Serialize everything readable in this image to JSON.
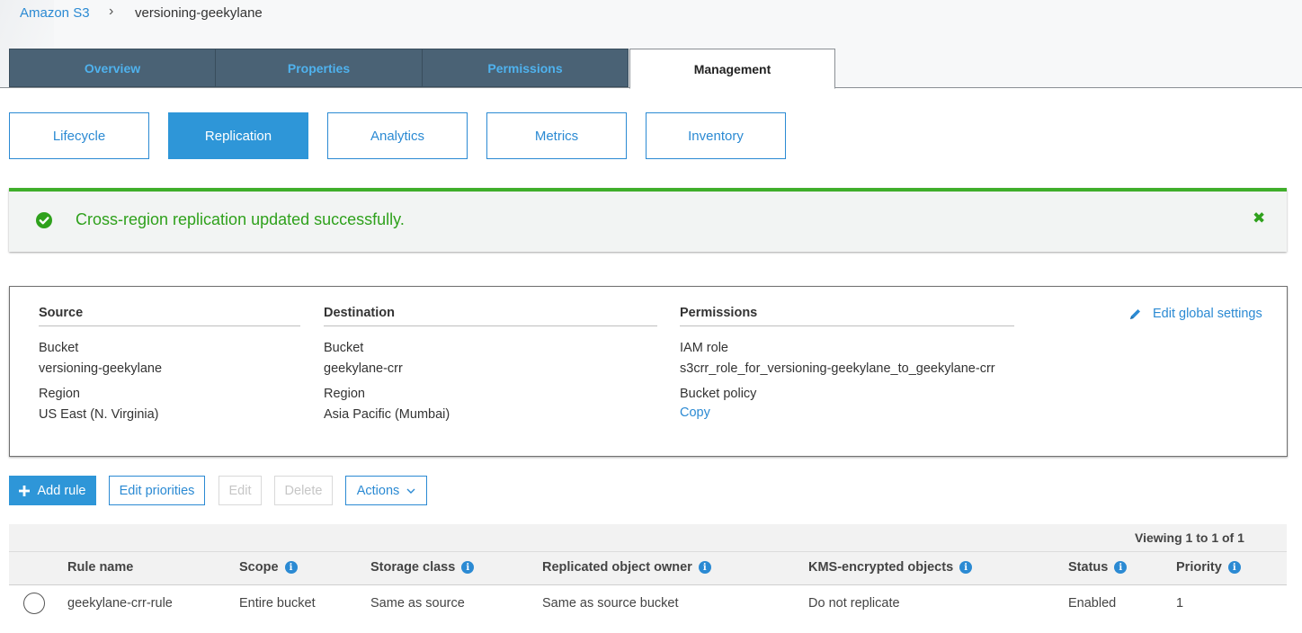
{
  "breadcrumb": {
    "root": "Amazon S3",
    "separator": "›",
    "current": "versioning-geekylane"
  },
  "tabs": [
    "Overview",
    "Properties",
    "Permissions",
    "Management"
  ],
  "active_tab": "Management",
  "subtabs": [
    "Lifecycle",
    "Replication",
    "Analytics",
    "Metrics",
    "Inventory"
  ],
  "active_subtab": "Replication",
  "banner": {
    "message": "Cross-region replication updated successfully.",
    "close": "✖",
    "color": "#3fae2a"
  },
  "config": {
    "source": {
      "heading": "Source",
      "bucket_label": "Bucket",
      "bucket": "versioning-geekylane",
      "region_label": "Region",
      "region": "US East (N. Virginia)"
    },
    "destination": {
      "heading": "Destination",
      "bucket_label": "Bucket",
      "bucket": "geekylane-crr",
      "region_label": "Region",
      "region": "Asia Pacific (Mumbai)"
    },
    "permissions": {
      "heading": "Permissions",
      "iam_label": "IAM role",
      "iam_role": "s3crr_role_for_versioning-geekylane_to_geekylane-crr",
      "policy_label": "Bucket policy",
      "copy": "Copy"
    },
    "edit_global": "Edit global settings"
  },
  "toolbar": {
    "add_rule": "Add rule",
    "edit_priorities": "Edit priorities",
    "edit": "Edit",
    "delete": "Delete",
    "actions": "Actions"
  },
  "table": {
    "viewing": "Viewing 1 to 1 of 1",
    "columns": {
      "rule_name": "Rule name",
      "scope": "Scope",
      "storage_class": "Storage class",
      "owner": "Replicated object owner",
      "kms": "KMS-encrypted objects",
      "status": "Status",
      "priority": "Priority"
    },
    "rows": [
      {
        "rule_name": "geekylane-crr-rule",
        "scope": "Entire bucket",
        "storage_class": "Same as source",
        "owner": "Same as source bucket",
        "kms": "Do not replicate",
        "status": "Enabled",
        "priority": "1"
      }
    ]
  },
  "colors": {
    "accent": "#2b8ad3",
    "tab_dark": "#4a6275",
    "success": "#3fae2a"
  }
}
